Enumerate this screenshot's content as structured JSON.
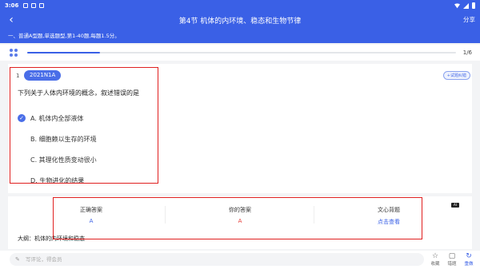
{
  "status": {
    "time": "3:06"
  },
  "header": {
    "back_icon": "back-chevron-icon",
    "title": "第4节 机体的内环境、稳态和生物节律",
    "share": "分享"
  },
  "notice": "一、普通A型题,单选题型,第1-40题,每题1.5分。",
  "progress": {
    "current": 1,
    "total": 6,
    "label": "1/6",
    "fraction": 0.17
  },
  "question": {
    "number": "1",
    "tag": "2021N1A",
    "report_button": "+试题纠错",
    "stem": "下列关于人体内环境的概念，叙述错误的是",
    "options": [
      {
        "letter": "A",
        "text": "A. 机体内全部液体",
        "selected": true
      },
      {
        "letter": "B",
        "text": "B. 细胞赖以生存的环境",
        "selected": false
      },
      {
        "letter": "C",
        "text": "C. 其理化性质变动很小",
        "selected": false
      },
      {
        "letter": "D",
        "text": "D. 生物进化的结果",
        "selected": false
      }
    ]
  },
  "answer": {
    "correct_label": "正确答案",
    "correct_value": "A",
    "yours_label": "你的答案",
    "yours_value": "A",
    "ai_label": "文心背题",
    "ai_link": "点击查看",
    "ai_badge": "AI",
    "outline": "大纲：机体的内环境和稳态"
  },
  "colors": {
    "brand": "#3a60e6",
    "correct": "#3a60e6",
    "yours": "#e53935",
    "link": "#3a60e6",
    "highlight_border": "#e02020"
  },
  "bottom": {
    "comment_placeholder": "写评论，得会员",
    "actions": [
      {
        "label": "收藏",
        "icon": "star-icon"
      },
      {
        "label": "错题",
        "icon": "clipboard-icon"
      },
      {
        "label": "重做",
        "icon": "redo-icon"
      }
    ]
  }
}
